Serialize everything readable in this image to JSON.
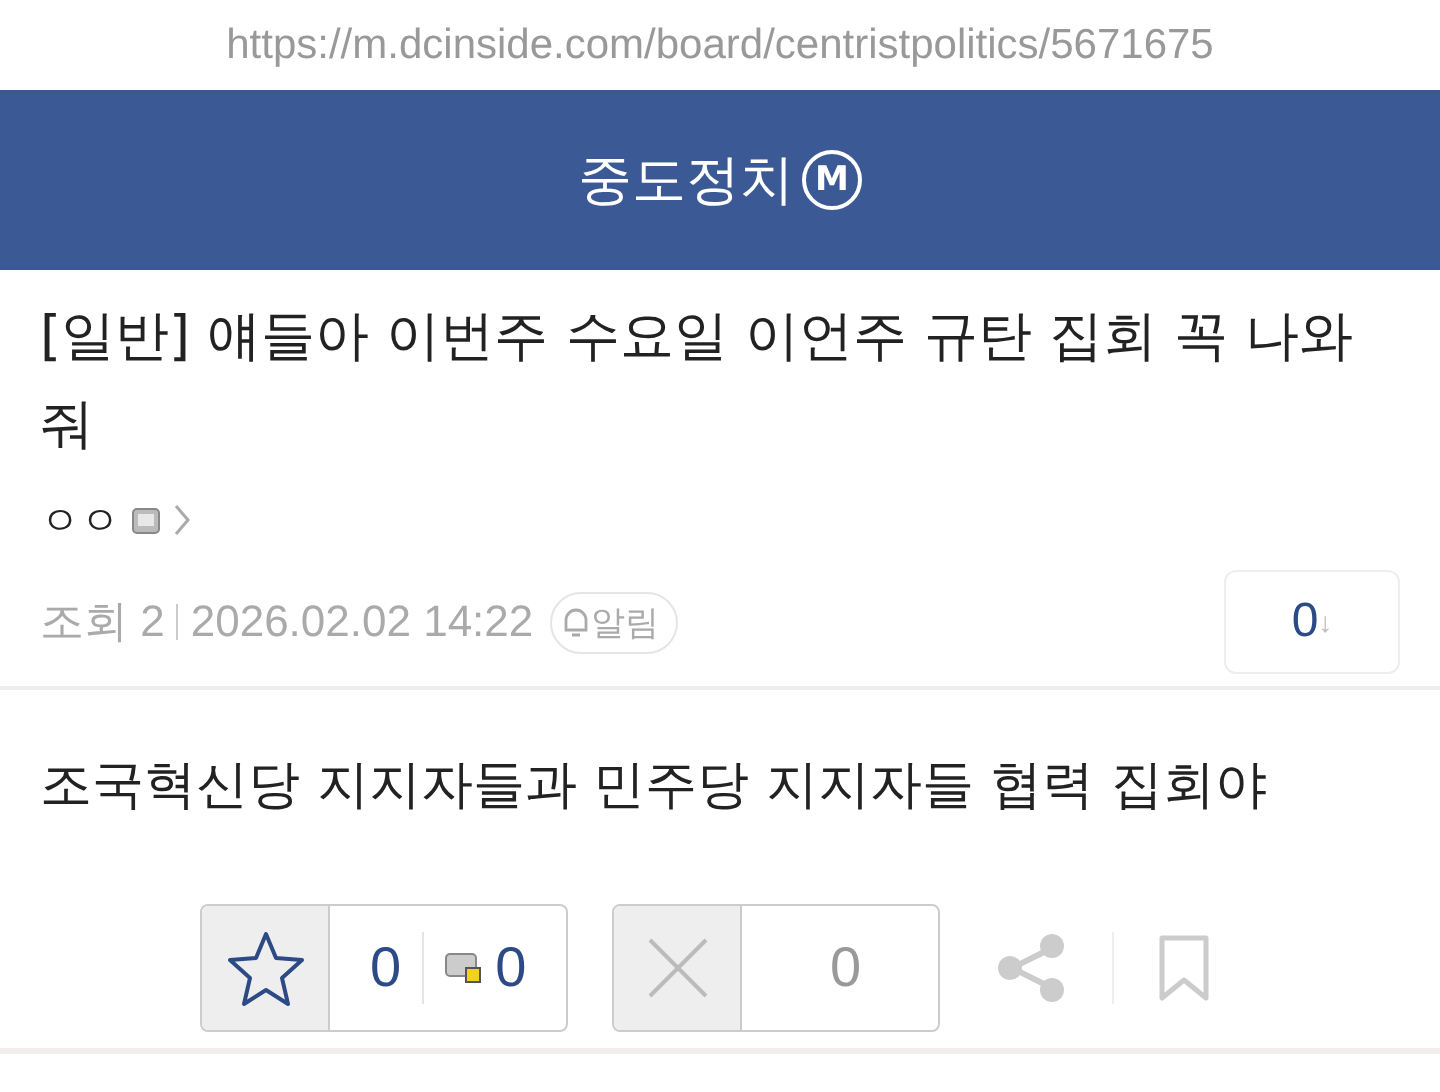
{
  "url": "https://m.dcinside.com/board/centristpolitics/5671675",
  "header": {
    "title": "중도정치",
    "badge": "M"
  },
  "post": {
    "title": "[일반] 얘들아 이번주 수요일 이언주 규탄 집회 꼭 나와줘",
    "author": "ㅇㅇ",
    "views": "조회 2",
    "date": "2026.02.02 14:22",
    "alert": "알림",
    "comment_count": "0",
    "arrow": "↓"
  },
  "body": "조국혁신당 지지자들과 민주당 지지자들 협력 집회야",
  "actions": {
    "upvotes": "0",
    "fixed_upvotes": "0",
    "downvotes": "0"
  }
}
